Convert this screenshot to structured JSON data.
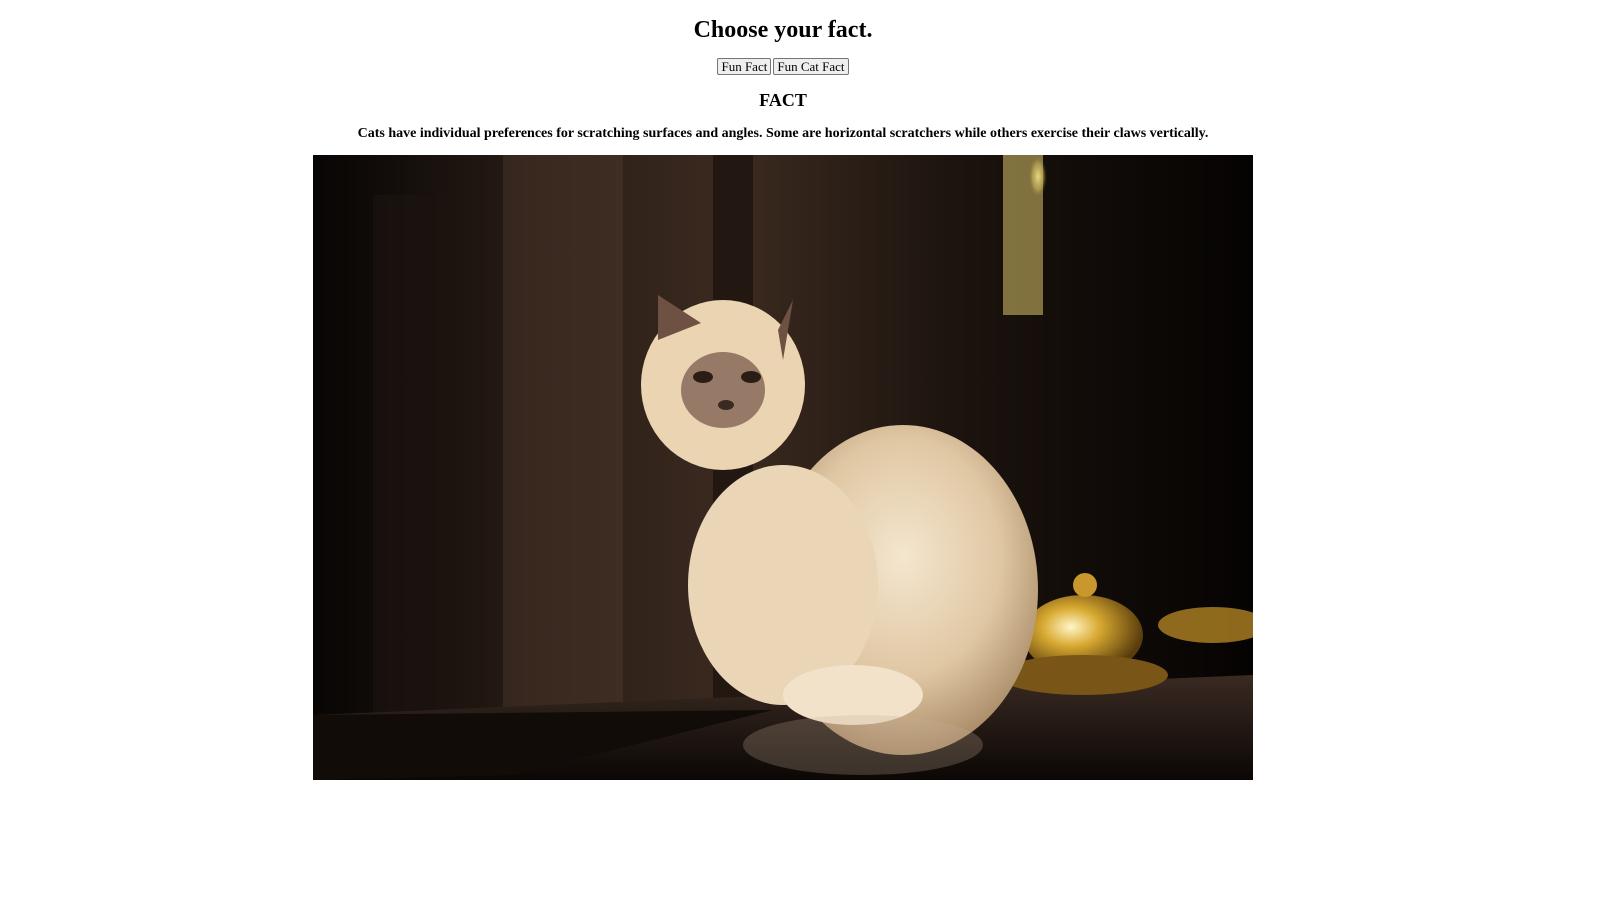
{
  "page": {
    "heading": "Choose your fact.",
    "buttons": [
      {
        "label": "Fun Fact"
      },
      {
        "label": "Fun Cat Fact"
      }
    ],
    "section_title": "FACT",
    "fact_text": "Cats have individual preferences for scratching surfaces and angles. Some are horizontal scratchers while others exercise their claws vertically.",
    "image": {
      "subject": "cat-photo"
    }
  }
}
